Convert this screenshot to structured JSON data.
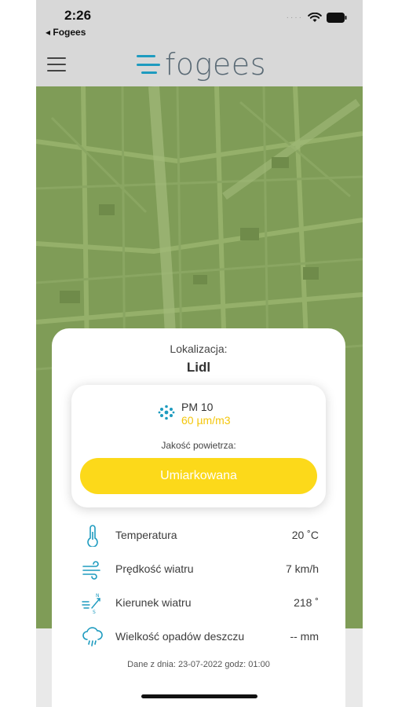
{
  "status_bar": {
    "time": "2:26",
    "back_label": "◂ Fogees",
    "signal": "····"
  },
  "header": {
    "logo_text": "fogees",
    "menu_icon": "hamburger-menu-icon",
    "accent": "#1e9bbf"
  },
  "sheet": {
    "location_label": "Lokalizacja:",
    "location_name": "Lidl",
    "pollutant": {
      "name": "PM 10",
      "value": "60 µm/m3",
      "icon": "particles-icon",
      "value_color": "#f4c60b"
    },
    "quality_label": "Jakość powietrza:",
    "quality_value": "Umiarkowana",
    "quality_color": "#fcd91a",
    "metrics": [
      {
        "icon": "thermometer-icon",
        "label": "Temperatura",
        "value": "20 ˚C"
      },
      {
        "icon": "wind-icon",
        "label": "Prędkość wiatru",
        "value": "7 km/h"
      },
      {
        "icon": "wind-direction-icon",
        "label": "Kierunek wiatru",
        "value": "218 ˚"
      },
      {
        "icon": "rain-cloud-icon",
        "label": "Wielkość opadów deszczu",
        "value": "-- mm"
      }
    ],
    "date_line": "Dane z dnia: 23-07-2022  godz: 01:00"
  }
}
